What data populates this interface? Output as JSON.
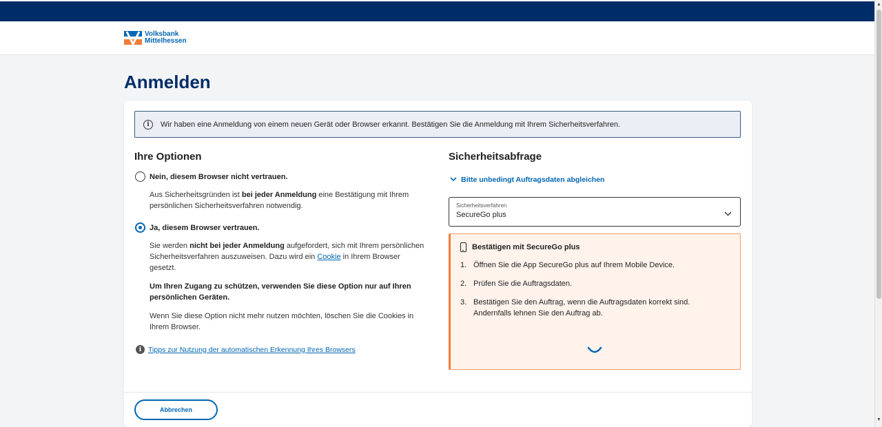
{
  "brand": {
    "name_line1": "Volksbank",
    "name_line2": "Mittelhessen"
  },
  "page": {
    "title": "Anmelden"
  },
  "info_banner": {
    "icon": "info-icon",
    "text": "Wir haben eine Anmeldung von einem neuen Gerät oder Browser erkannt. Bestätigen Sie die Anmeldung mit Ihrem Sicherheitsverfahren."
  },
  "options": {
    "title": "Ihre Optionen",
    "option_no": {
      "label": "Nein, diesem Browser nicht vertrauen.",
      "selected": false,
      "desc_part1": "Aus Sicherheitsgründen ist ",
      "desc_bold": "bei jeder Anmeldung",
      "desc_part2": " eine Bestätigung mit Ihrem persönlichen Sicherheitsverfahren notwendig."
    },
    "option_yes": {
      "label": "Ja, diesem Browser vertrauen.",
      "selected": true,
      "desc_part1": "Sie werden ",
      "desc_bold": "nicht bei jeder Anmeldung",
      "desc_part2": " aufgefordert, sich mit Ihrem persönlichen Sicherheitsverfahren auszuweisen. Dazu wird ein ",
      "desc_link": "Cookie",
      "desc_part3": " in Ihrem Browser gesetzt.",
      "warning": "Um Ihren Zugang zu schützen, verwenden Sie diese Option nur auf Ihren persönlichen Geräten.",
      "note": "Wenn Sie diese Option nicht mehr nutzen möchten, löschen Sie die Cookies in Ihrem Browser."
    },
    "tips_link": "Tipps zur Nutzung der automatischen Erkennung Ihres Browsers"
  },
  "security": {
    "title": "Sicherheitsabfrage",
    "expand_link": "Bitte unbedingt Auftragsdaten abgleichen",
    "select": {
      "label": "Sicherheitsverfahren",
      "value": "SecureGo plus"
    },
    "confirm": {
      "title": "Bestätigen mit SecureGo plus",
      "steps": [
        {
          "num": "1.",
          "text": "Öffnen Sie die App SecureGo plus auf Ihrem Mobile Device."
        },
        {
          "num": "2.",
          "text": "Prüfen Sie die Auftragsdaten."
        },
        {
          "num": "3.",
          "text": "Bestätigen Sie den Auftrag, wenn die Auftragsdaten korrekt sind. Andernfalls lehnen Sie den Auftrag ab."
        }
      ]
    }
  },
  "footer": {
    "cancel_label": "Abbrechen"
  },
  "colors": {
    "brand_navy": "#002d67",
    "brand_blue": "#0066b3",
    "brand_orange": "#f07c38",
    "info_bg": "#ebeff5",
    "confirm_bg": "#fff3ec"
  }
}
